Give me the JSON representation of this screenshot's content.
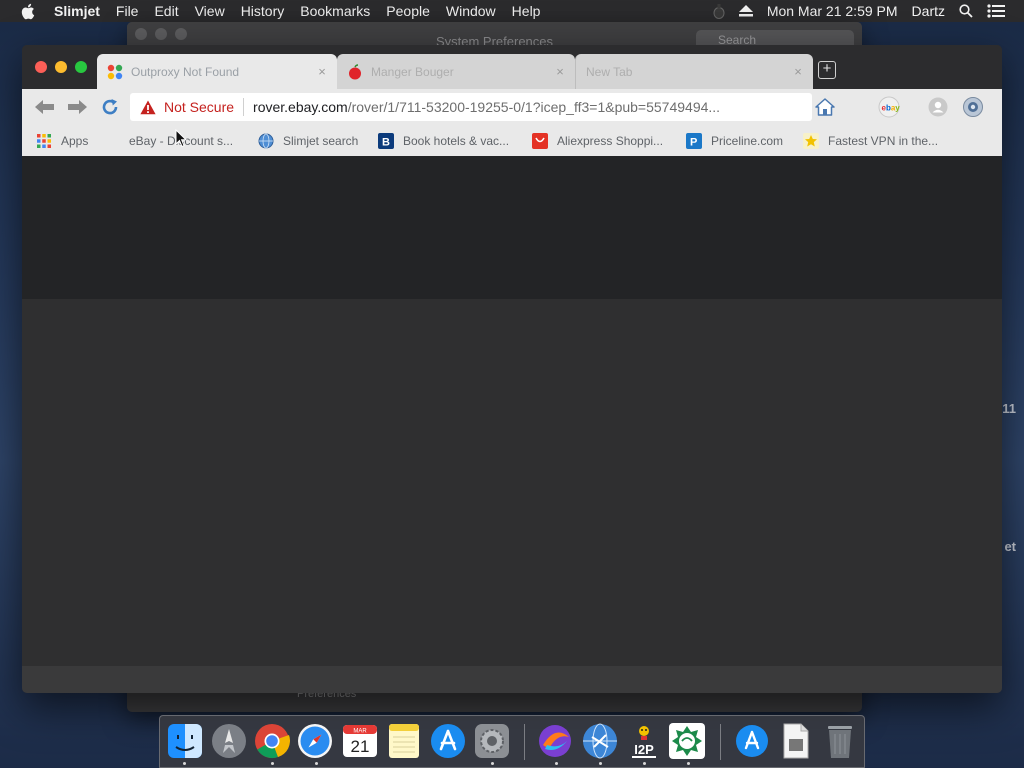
{
  "menubar": {
    "app_name": "Slimjet",
    "items": [
      "File",
      "Edit",
      "View",
      "History",
      "Bookmarks",
      "People",
      "Window",
      "Help"
    ],
    "clock": "Mon Mar 21  2:59 PM",
    "user": "Dartz"
  },
  "background_window": {
    "title": "System Preferences",
    "search_placeholder": "Search",
    "footer_text": "Preferences",
    "side_fragment_1": "11",
    "side_fragment_2": "et"
  },
  "browser": {
    "tabs": [
      {
        "title": "Outproxy Not Found",
        "active": true
      },
      {
        "title": "Manger Bouger",
        "active": false
      },
      {
        "title": "New Tab",
        "active": false
      }
    ],
    "new_tab_symbol": "+",
    "close_symbol": "×",
    "omnibox": {
      "security_label": "Not Secure",
      "url_host": "rover.ebay.com",
      "url_path": "/rover/1/711-53200-19255-0/1?icep_ff3=1&pub=55749494..."
    },
    "bookmarks": [
      {
        "label": "Apps",
        "icon": "apps-grid-icon"
      },
      {
        "label": "eBay - Discount s...",
        "icon": "none"
      },
      {
        "label": "Slimjet search",
        "icon": "globe-icon"
      },
      {
        "label": "Book hotels & vac...",
        "icon": "booking-icon"
      },
      {
        "label": "Aliexpress Shoppi...",
        "icon": "aliexpress-icon"
      },
      {
        "label": "Priceline.com",
        "icon": "priceline-icon"
      },
      {
        "label": "Fastest VPN in the...",
        "icon": "vpn-icon"
      }
    ]
  },
  "dock": {
    "calendar_month": "MAR",
    "calendar_day": "21",
    "i2p_label": "I2P",
    "apps": [
      "Finder",
      "Launchpad",
      "Chrome",
      "Safari",
      "Calendar",
      "Notes",
      "App Store",
      "System Preferences",
      "Slimjet",
      "Network",
      "I2P",
      "Tor",
      "App Store Downloads",
      "Preview",
      "Trash"
    ]
  },
  "colors": {
    "accent_red": "#c5221f",
    "traffic_red": "#fc5f57",
    "traffic_yellow": "#fdbc2e",
    "traffic_green": "#28c840"
  }
}
